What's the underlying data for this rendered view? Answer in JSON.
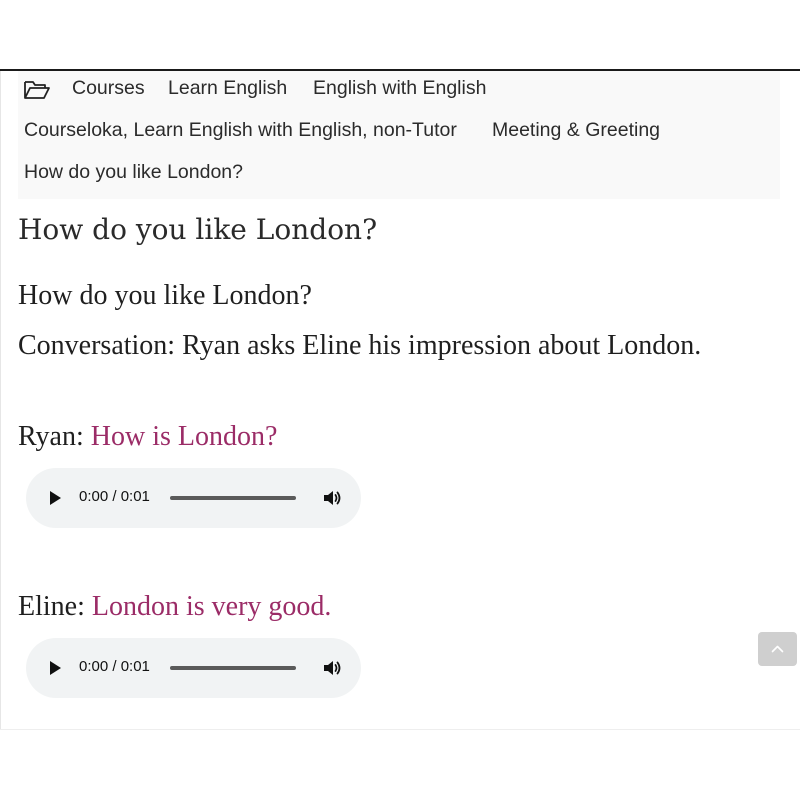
{
  "breadcrumb": {
    "icon": "folder-open-icon",
    "items": [
      {
        "label": "Courses"
      },
      {
        "label": "Learn English"
      },
      {
        "label": "English with English"
      },
      {
        "label": "Courseloka, Learn English with English, non-Tutor"
      },
      {
        "label": "Meeting & Greeting"
      },
      {
        "label": "How do you like London?"
      }
    ]
  },
  "page": {
    "title": "How do you like London?",
    "subtitle": "How do you like London?",
    "description": "Conversation: Ryan asks Eline his impression about London."
  },
  "dialogue": [
    {
      "speaker": "Ryan:",
      "line": "How is London?",
      "audio": {
        "time": "0:00 / 0:01"
      }
    },
    {
      "speaker": "Eline:",
      "line": "London is very good.",
      "audio": {
        "time": "0:00 / 0:01"
      }
    }
  ],
  "colors": {
    "speech": "#9b2c67",
    "breadcrumb_bg": "#f9f9f9",
    "player_bg": "#f1f3f4",
    "back_to_top_bg": "#cfcfcf"
  },
  "icons": {
    "play": "play-icon",
    "volume": "volume-icon",
    "back_to_top": "chevron-up-icon"
  }
}
